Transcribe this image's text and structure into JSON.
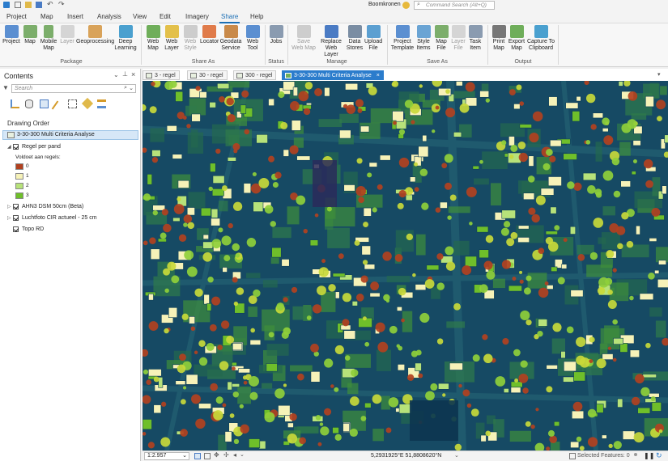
{
  "titlebar": {
    "project_name": "Boomkronen",
    "search_placeholder": "Command Search (Alt+Q)"
  },
  "menu": {
    "items": [
      "Project",
      "Map",
      "Insert",
      "Analysis",
      "View",
      "Edit",
      "Imagery",
      "Share",
      "Help"
    ],
    "active": "Share"
  },
  "ribbon": {
    "package": {
      "label": "Package",
      "buttons": [
        "Project",
        "Map",
        "Mobile Map",
        "Layer",
        "Geoprocessing",
        "Deep Learning"
      ]
    },
    "share_as": {
      "label": "Share As",
      "buttons": [
        "Web Map",
        "Web Layer",
        "Web Style",
        "Locator",
        "Geodata Service",
        "Web Tool"
      ]
    },
    "status": {
      "label": "Status",
      "buttons": [
        "Jobs"
      ]
    },
    "manage": {
      "label": "Manage",
      "buttons": [
        "Save Web Map",
        "Replace Web Layer",
        "Data Stores",
        "Upload File"
      ]
    },
    "save_as": {
      "label": "Save As",
      "buttons": [
        "Project Template",
        "Style Items",
        "Map File",
        "Layer File",
        "Task Item"
      ]
    },
    "output": {
      "label": "Output",
      "buttons": [
        "Print Map",
        "Export Map",
        "Capture To Clipboard"
      ]
    }
  },
  "contents": {
    "title": "Contents",
    "search_placeholder": "Search",
    "drawing_order": "Drawing Order",
    "map_name": "3-30-300 Multi Criteria Analyse",
    "layer_regel": "Regel per pand",
    "legend_heading": "Voldoet aan regels:",
    "legend": [
      {
        "label": "0",
        "color": "#b2411f"
      },
      {
        "label": "1",
        "color": "#f6f2b8"
      },
      {
        "label": "2",
        "color": "#b7e27a"
      },
      {
        "label": "3",
        "color": "#6fbf2a"
      }
    ],
    "layer_ahn": "AHN3 DSM 50cm (Beta)",
    "layer_luchtfoto": "Luchtfoto CIR actueel - 25 cm",
    "layer_topo": "Topo RD"
  },
  "tabs": [
    "3 - regel",
    "30 - regel",
    "300 - regel",
    "3-30-300 Multi Criteria Analyse"
  ],
  "status": {
    "scale": "1:2.957",
    "coordinates": "5,2931925°E 51,8808620°N",
    "selected_features": "Selected Features: 0"
  },
  "colors": {
    "accent": "#2b7ccc",
    "map_bg": "#0f3f58",
    "rule0": "#b2411f",
    "rule1": "#f6f2b8",
    "rule2": "#b7e27a",
    "rule3": "#6fbf2a"
  }
}
